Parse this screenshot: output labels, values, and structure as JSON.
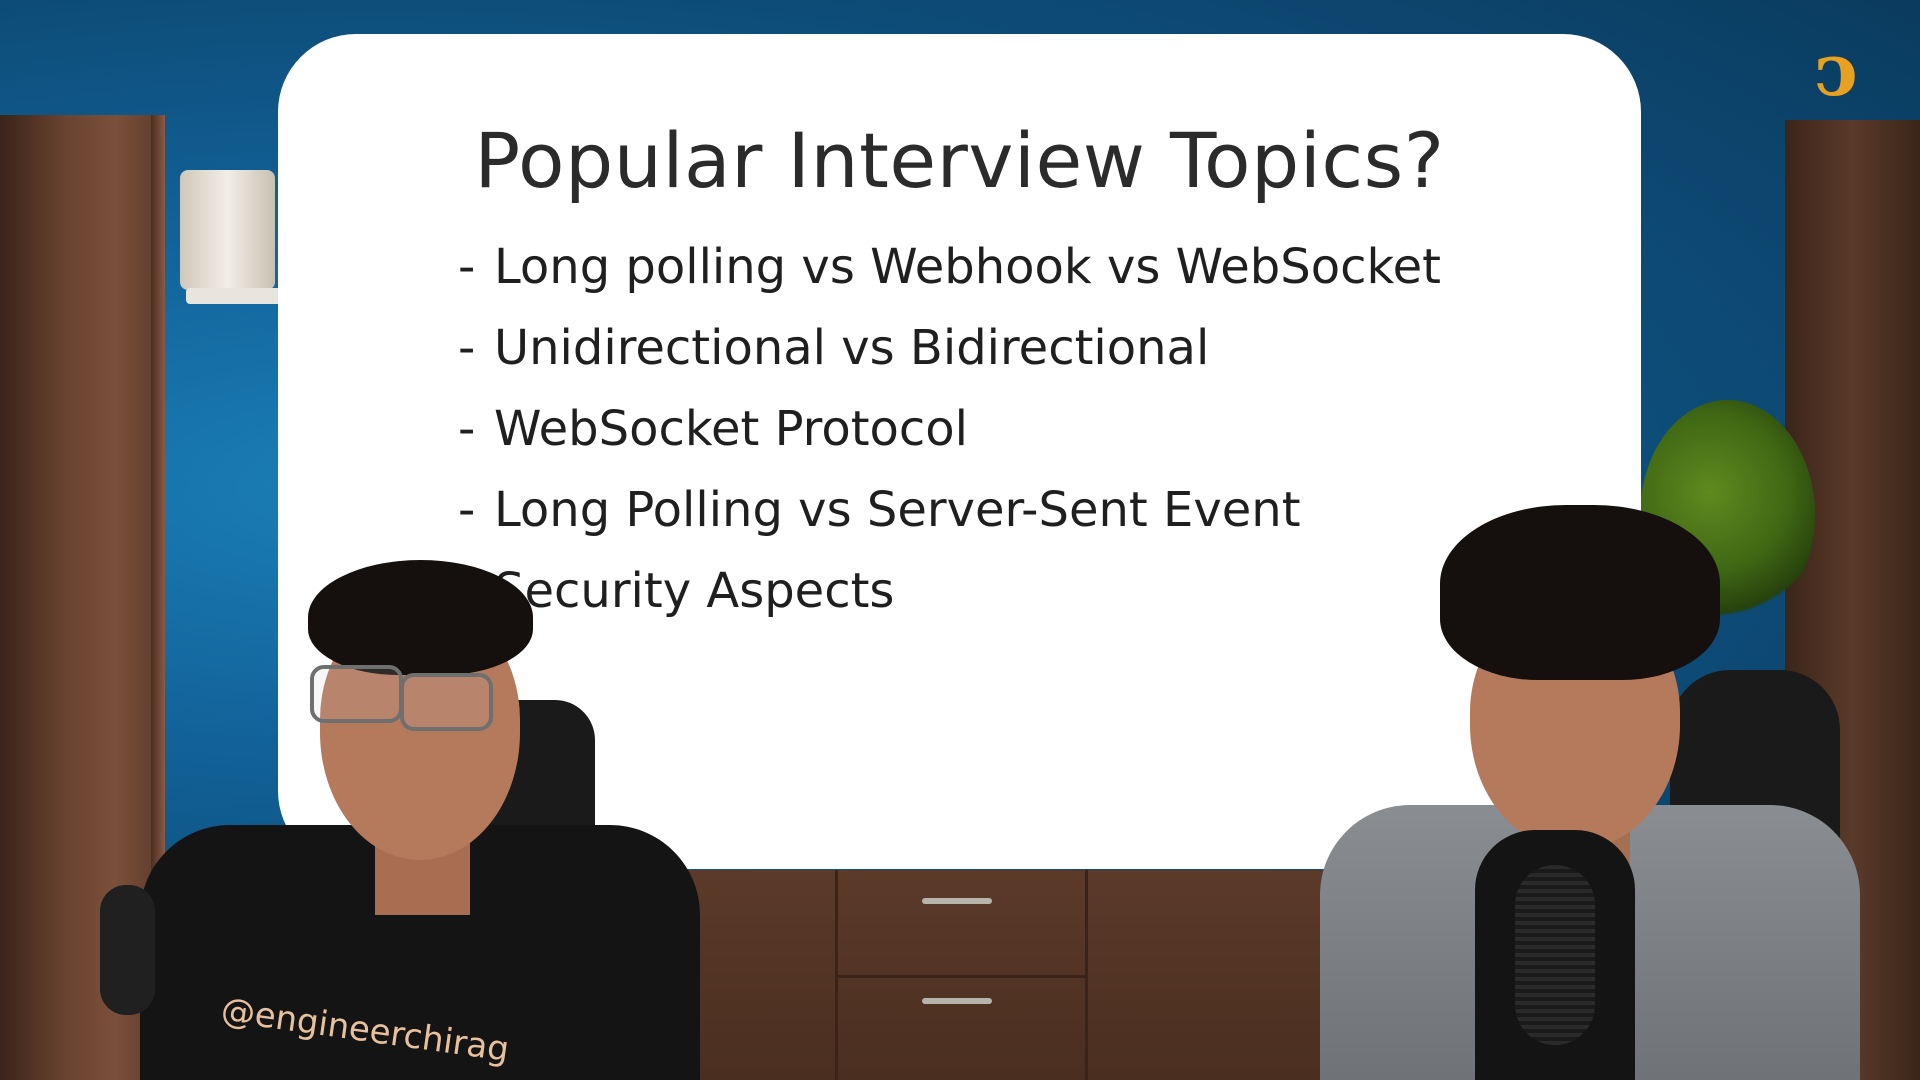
{
  "slide": {
    "title": "Popular Interview Topics?",
    "topics": [
      "Long polling vs Webhook vs WebSocket",
      "Unidirectional vs Bidirectional",
      "WebSocket Protocol",
      "Long Polling vs Server-Sent Event",
      "Security Aspects"
    ]
  },
  "host_left": {
    "shirt_text": "@engineerchirag"
  },
  "colors": {
    "wall": "#12639a",
    "wood": "#6a4331",
    "slide_bg": "#ffffff",
    "slide_text": "#2b2b2b",
    "logo": "#e7a020"
  },
  "icons": {
    "logo": "channel-logo-icon"
  }
}
